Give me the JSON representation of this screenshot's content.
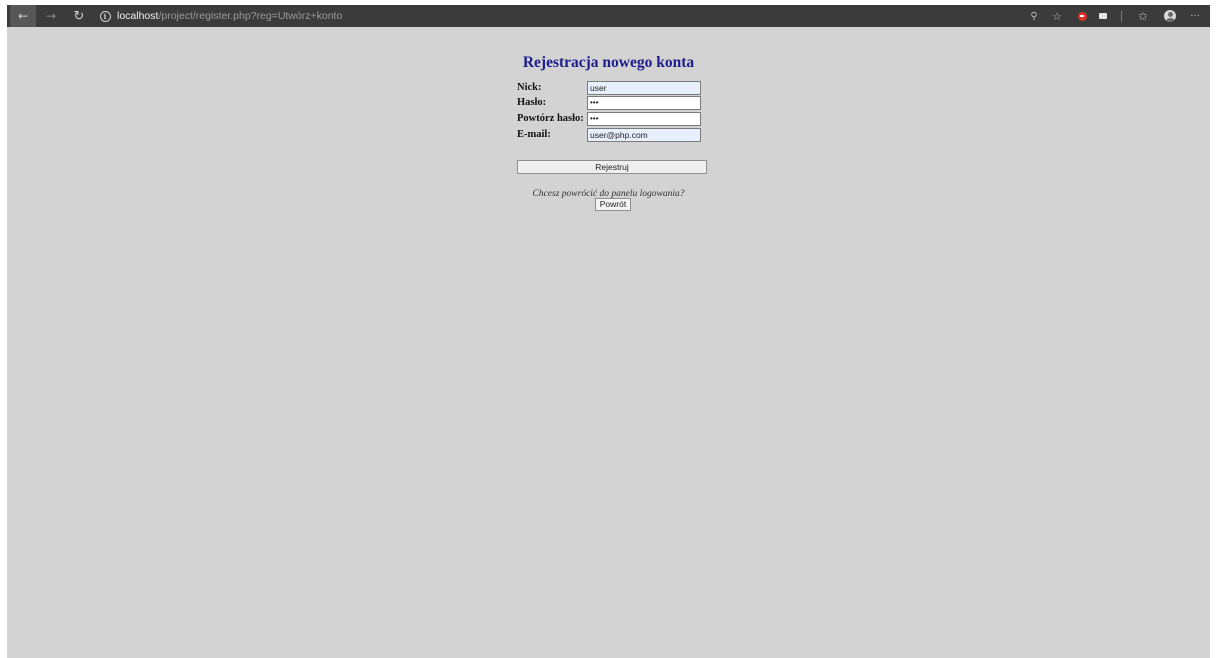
{
  "browser": {
    "address_host": "localhost",
    "address_path": "/project/register.php?reg=Utwórz+konto",
    "icons": {
      "back": "arrow-left-icon",
      "forward": "arrow-right-icon",
      "reload": "reload-icon",
      "site_info": "info-icon",
      "key": "key-icon",
      "add_favorite": "star-plus-icon",
      "extension_red": "red-extension-icon",
      "extension_mail": "mail-extension-icon",
      "favorites": "favorites-icon",
      "profile": "profile-avatar-icon",
      "menu": "more-icon"
    },
    "glyphs": {
      "back": "←",
      "forward": "→",
      "reload": "↻",
      "info": "i",
      "key": "⚲",
      "add_favorite": "☆",
      "collections": "✩",
      "menu": "···"
    }
  },
  "page": {
    "title": "Rejestracja nowego konta",
    "form": {
      "nick_label": "Nick:",
      "nick_value": "user",
      "password_label": "Hasło:",
      "password_value": "•••",
      "repeat_label": "Powtórz hasło:",
      "repeat_value": "•••",
      "email_label": "E-mail:",
      "email_value": "user@php.com",
      "submit_label": "Rejestruj"
    },
    "back": {
      "question": "Chcesz powrócić do panelu logowania?",
      "button_label": "Powrót"
    }
  },
  "colors": {
    "page_background": "#d3d3d3",
    "title": "#1c1c8c",
    "toolbar": "#3b3b3b",
    "autofill_field": "#e8f0fe"
  }
}
